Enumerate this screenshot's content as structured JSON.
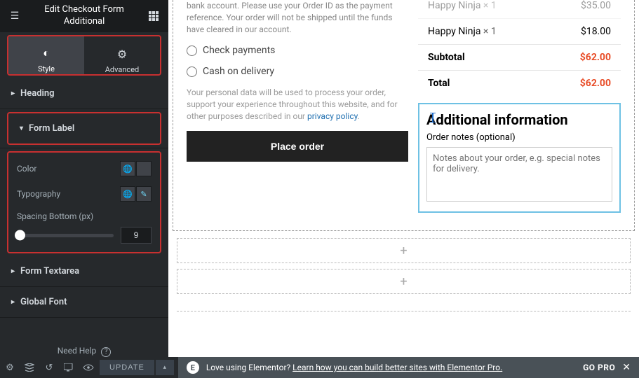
{
  "header": {
    "title_line1": "Edit Checkout Form",
    "title_line2": "Additional"
  },
  "tabs": {
    "style": "Style",
    "advanced": "Advanced"
  },
  "sections": {
    "heading": "Heading",
    "form_label": "Form Label",
    "form_textarea": "Form Textarea",
    "global_font": "Global Font"
  },
  "controls": {
    "color_label": "Color",
    "typo_label": "Typography",
    "spacing_label": "Spacing Bottom (px)",
    "spacing_value": "9"
  },
  "need_help": "Need Help",
  "canvas": {
    "bank_desc": "bank account. Please use your Order ID as the payment reference. Your order will not be shipped until the funds have cleared in our account.",
    "check": "Check payments",
    "cash": "Cash on delivery",
    "privacy_pre": "Your personal data will be used to process your order, support your experience throughout this website, and for other purposes described in our ",
    "privacy_link": "privacy policy",
    "place_order": "Place order",
    "order": {
      "row0": {
        "name": "Happy Ninja",
        "qty": "× 1",
        "price": "$35.00"
      },
      "row1": {
        "name": "Happy Ninja",
        "qty": "× 1",
        "price": "$18.00"
      },
      "subtotal_label": "Subtotal",
      "subtotal_price": "$62.00",
      "total_label": "Total",
      "total_price": "$62.00"
    },
    "addl_title": "Additional information",
    "addl_sub": "Order notes (optional)",
    "notes_placeholder": "Notes about your order, e.g. special notes for delivery."
  },
  "footer": {
    "update": "UPDATE",
    "promo_text": "Love using Elementor?",
    "promo_link": "Learn how you can build better sites with Elementor Pro.",
    "go_pro": "GO PRO"
  }
}
